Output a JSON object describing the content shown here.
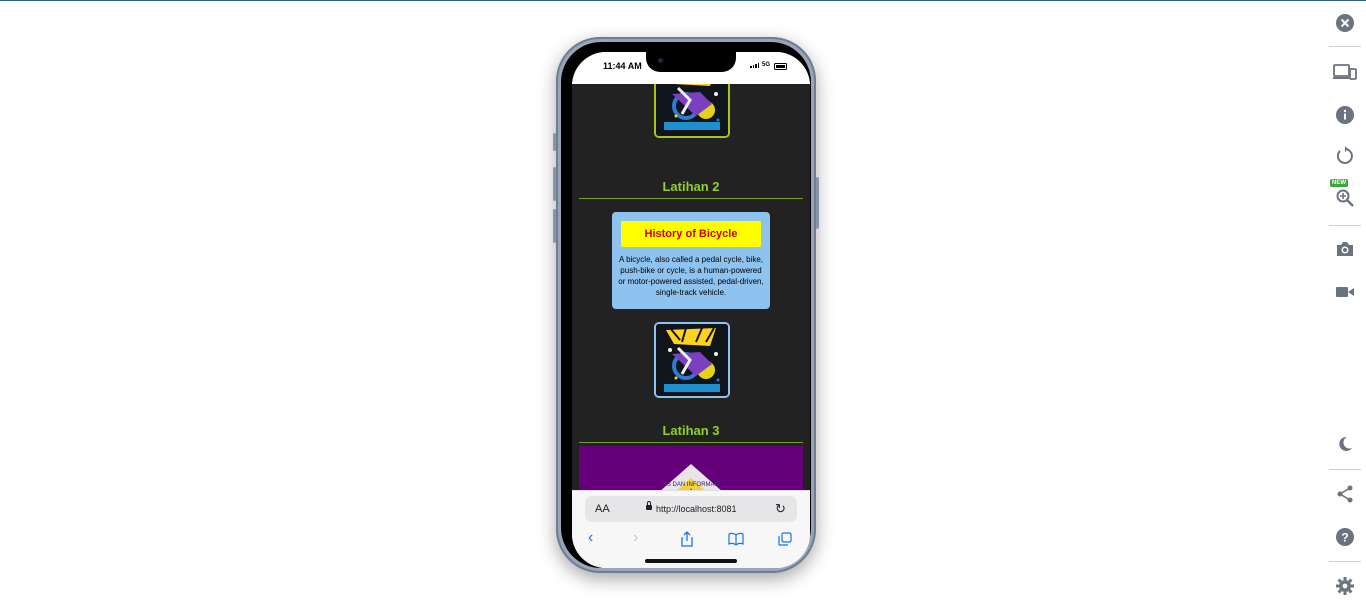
{
  "phone": {
    "status": {
      "time": "11:44 AM",
      "network": "5G"
    },
    "page": {
      "sections": [
        {
          "title": "Latihan 2"
        },
        {
          "title": "Latihan 3"
        }
      ],
      "card": {
        "title": "History of Bicycle",
        "text": "A bicycle, also called a pedal cycle, bike, push-bike or cycle, is a human-powered or motor-powered assisted, pedal-driven, single-track vehicle."
      },
      "image_top_name": "bmx-freestyle-image",
      "logo_text": "US DAN INFORMATI"
    },
    "browser": {
      "aa_label": "AA",
      "url": "http://localhost:8081"
    }
  },
  "toolbar": {
    "icons": [
      "close-icon",
      "devices-icon",
      "info-icon",
      "rotate-icon",
      "zoom-icon",
      "camera-icon",
      "video-icon",
      "dark-mode-icon",
      "share-icon",
      "help-icon",
      "settings-icon"
    ],
    "new_badge": "NEW"
  },
  "colors": {
    "accent_green": "#8fd124",
    "card_bg": "#8ec3ef",
    "card_title_bg": "#ffff00",
    "card_title_text": "#d40000",
    "page_bg": "#222222",
    "purple_block": "#66007a",
    "toolbar_icon": "#6b7280"
  }
}
